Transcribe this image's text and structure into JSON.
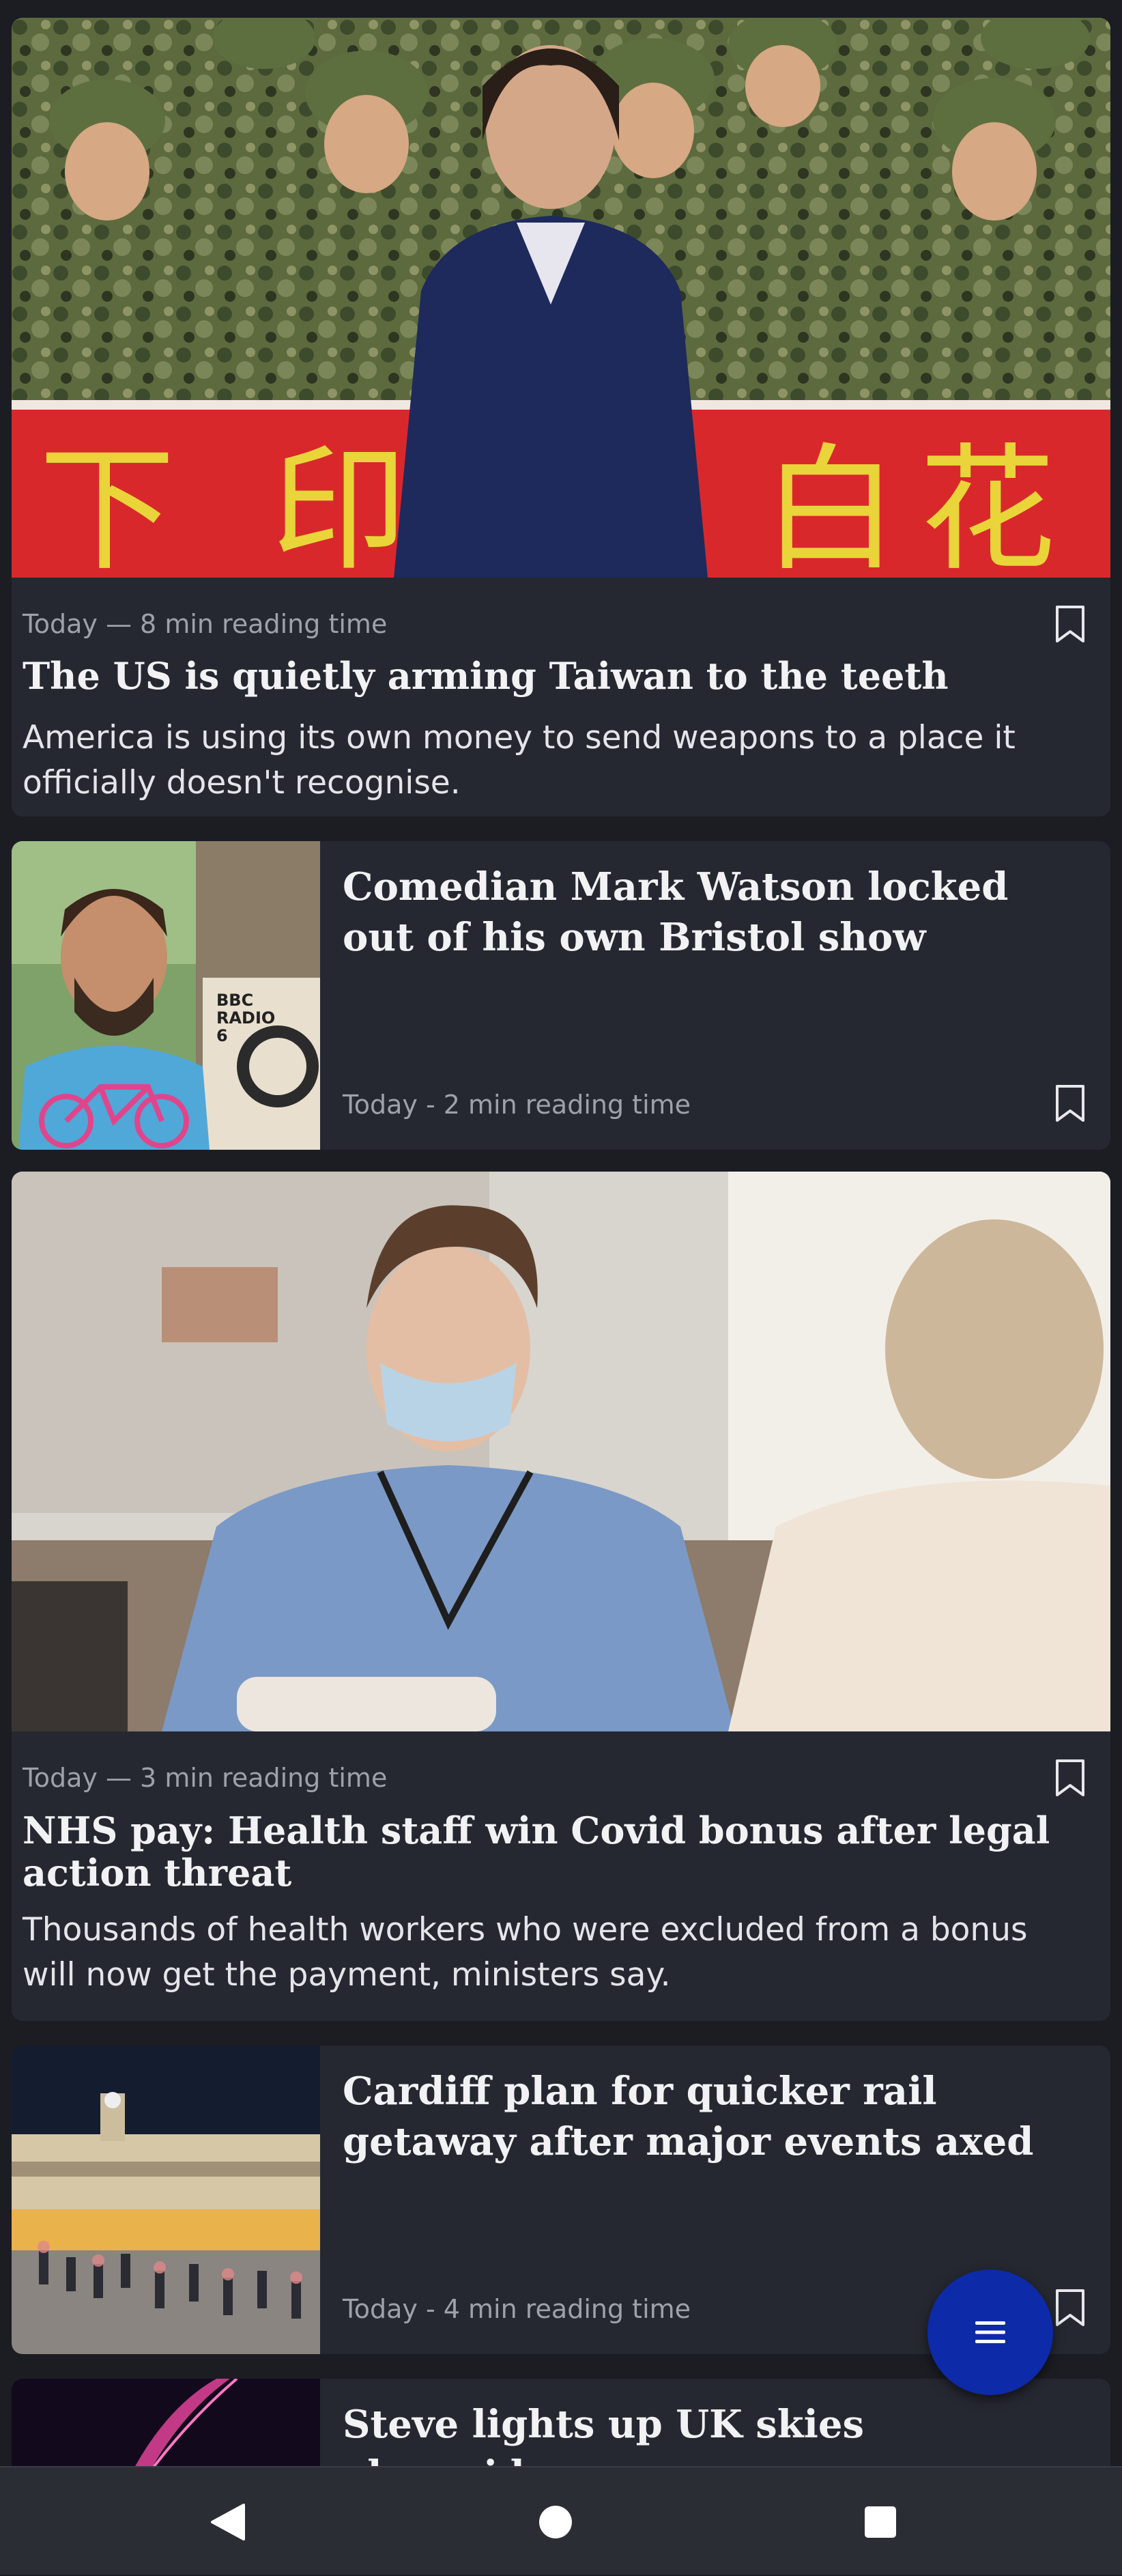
{
  "articles": [
    {
      "layout": "hero",
      "image_icon": "news-photo-icon",
      "meta": "Today — 8 min reading time",
      "title": "The US is quietly arming Taiwan to the teeth",
      "description": "America is using its own money to send weapons to a place it officially doesn't recognise."
    },
    {
      "layout": "thumbnail",
      "image_icon": "news-photo-icon",
      "meta": "Today - 2 min reading time",
      "title": "Comedian Mark Watson locked out of his own Bristol show",
      "thumb_text": "BBC RADIO 6"
    },
    {
      "layout": "hero",
      "image_icon": "news-photo-icon",
      "meta": "Today — 3 min reading time",
      "title": "NHS pay: Health staff win Covid bonus after legal action threat",
      "description": "Thousands of health workers who were excluded from a bonus will now get the payment, ministers say."
    },
    {
      "layout": "thumbnail",
      "image_icon": "news-photo-icon",
      "meta": "Today - 4 min reading time",
      "title": "Cardiff plan for quicker rail getaway after major events axed"
    },
    {
      "layout": "thumbnail",
      "image_icon": "news-photo-icon",
      "title": "Steve lights up UK skies alongside"
    }
  ],
  "fab": {
    "icon": "menu-icon"
  },
  "navbar": {
    "back_icon": "back-triangle-icon",
    "home_icon": "home-circle-icon",
    "recents_icon": "recents-square-icon"
  },
  "colors": {
    "background": "#1b1d23",
    "card": "#262831",
    "fab": "#0d2aa8",
    "meta_text": "#9ea1ab"
  }
}
